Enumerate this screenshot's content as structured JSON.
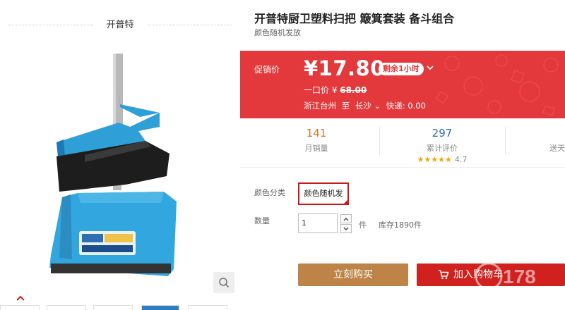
{
  "store": {
    "name": "开普特"
  },
  "product": {
    "title": "开普特厨卫塑料扫把 簸箕套装 备斗组合",
    "subtitle": "颜色随机发放"
  },
  "price": {
    "promo_label": "促销价",
    "current": "¥17.80",
    "badge": "剩余1小时",
    "original_label": "一口价 ¥",
    "original_value": "68.00",
    "shipping_from": "浙江台州",
    "shipping_to_word": "至",
    "shipping_to": "长沙",
    "shipping_fee": "快递: 0.00"
  },
  "stats": [
    {
      "value": "141",
      "label": "月销量"
    },
    {
      "value": "297",
      "label": "累计评价",
      "stars": "★★★★★",
      "rating": "4.7"
    },
    {
      "value": "",
      "label": "送天"
    }
  ],
  "options": {
    "color_label": "颜色分类",
    "color_value": "颜色随机发",
    "qty_label": "数量",
    "qty_value": "1",
    "qty_unit": "件",
    "stock": "库存1890件"
  },
  "actions": {
    "buy_now": "立刻购买",
    "add_cart": "加入购物车"
  },
  "watermark": {
    "text": "178"
  },
  "colors": {
    "price_bg": "#e4393c",
    "buy_now": "#bd8347",
    "add_cart": "#d0211f",
    "product_blue": "#2f9fd8"
  }
}
